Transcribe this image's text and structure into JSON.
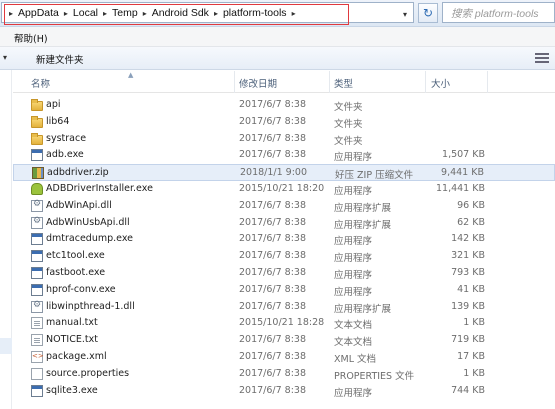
{
  "address_bar": {
    "breadcrumbs": [
      "AppData",
      "Local",
      "Temp",
      "Android Sdk",
      "platform-tools"
    ],
    "search_placeholder": "搜索 platform-tools"
  },
  "menu": {
    "help_label": "帮助(H)"
  },
  "toolbar": {
    "new_folder_label": "新建文件夹"
  },
  "columns": {
    "name": "名称",
    "date": "修改日期",
    "type": "类型",
    "size": "大小"
  },
  "files": [
    {
      "name": "api",
      "date": "2017/6/7 8:38",
      "type": "文件夹",
      "size": "",
      "icon": "folder"
    },
    {
      "name": "lib64",
      "date": "2017/6/7 8:38",
      "type": "文件夹",
      "size": "",
      "icon": "folder"
    },
    {
      "name": "systrace",
      "date": "2017/6/7 8:38",
      "type": "文件夹",
      "size": "",
      "icon": "folder"
    },
    {
      "name": "adb.exe",
      "date": "2017/6/7 8:38",
      "type": "应用程序",
      "size": "1,507 KB",
      "icon": "exe"
    },
    {
      "name": "adbdriver.zip",
      "date": "2018/1/1 9:00",
      "type": "好压 ZIP 压缩文件",
      "size": "9,441 KB",
      "icon": "zip",
      "selected": true
    },
    {
      "name": "ADBDriverInstaller.exe",
      "date": "2015/10/21 18:20",
      "type": "应用程序",
      "size": "11,441 KB",
      "icon": "android"
    },
    {
      "name": "AdbWinApi.dll",
      "date": "2017/6/7 8:38",
      "type": "应用程序扩展",
      "size": "96 KB",
      "icon": "dll"
    },
    {
      "name": "AdbWinUsbApi.dll",
      "date": "2017/6/7 8:38",
      "type": "应用程序扩展",
      "size": "62 KB",
      "icon": "dll"
    },
    {
      "name": "dmtracedump.exe",
      "date": "2017/6/7 8:38",
      "type": "应用程序",
      "size": "142 KB",
      "icon": "exe"
    },
    {
      "name": "etc1tool.exe",
      "date": "2017/6/7 8:38",
      "type": "应用程序",
      "size": "321 KB",
      "icon": "exe"
    },
    {
      "name": "fastboot.exe",
      "date": "2017/6/7 8:38",
      "type": "应用程序",
      "size": "793 KB",
      "icon": "exe"
    },
    {
      "name": "hprof-conv.exe",
      "date": "2017/6/7 8:38",
      "type": "应用程序",
      "size": "41 KB",
      "icon": "exe"
    },
    {
      "name": "libwinpthread-1.dll",
      "date": "2017/6/7 8:38",
      "type": "应用程序扩展",
      "size": "139 KB",
      "icon": "dll"
    },
    {
      "name": "manual.txt",
      "date": "2015/10/21 18:28",
      "type": "文本文档",
      "size": "1 KB",
      "icon": "txt"
    },
    {
      "name": "NOTICE.txt",
      "date": "2017/6/7 8:38",
      "type": "文本文档",
      "size": "719 KB",
      "icon": "txt"
    },
    {
      "name": "package.xml",
      "date": "2017/6/7 8:38",
      "type": "XML 文档",
      "size": "17 KB",
      "icon": "xml"
    },
    {
      "name": "source.properties",
      "date": "2017/6/7 8:38",
      "type": "PROPERTIES 文件",
      "size": "1 KB",
      "icon": "prop"
    },
    {
      "name": "sqlite3.exe",
      "date": "2017/6/7 8:38",
      "type": "应用程序",
      "size": "744 KB",
      "icon": "exe"
    }
  ]
}
